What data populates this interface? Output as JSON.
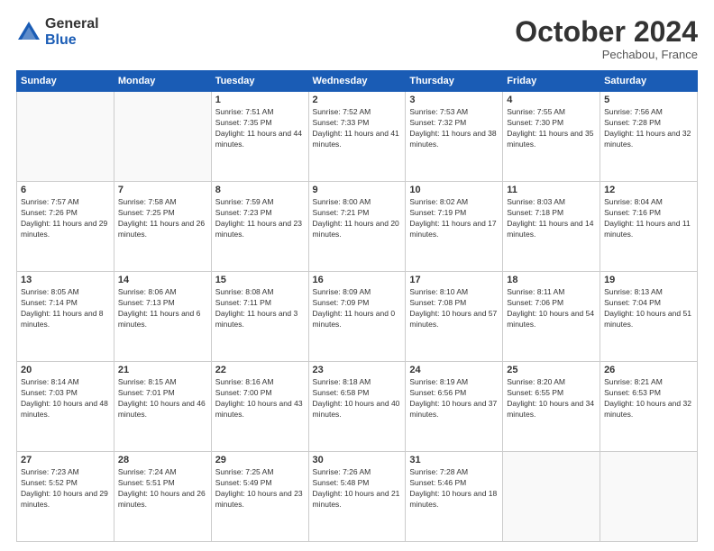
{
  "header": {
    "logo_general": "General",
    "logo_blue": "Blue",
    "month": "October 2024",
    "location": "Pechabou, France"
  },
  "days_of_week": [
    "Sunday",
    "Monday",
    "Tuesday",
    "Wednesday",
    "Thursday",
    "Friday",
    "Saturday"
  ],
  "weeks": [
    [
      {
        "day": "",
        "info": ""
      },
      {
        "day": "",
        "info": ""
      },
      {
        "day": "1",
        "info": "Sunrise: 7:51 AM\nSunset: 7:35 PM\nDaylight: 11 hours and 44 minutes."
      },
      {
        "day": "2",
        "info": "Sunrise: 7:52 AM\nSunset: 7:33 PM\nDaylight: 11 hours and 41 minutes."
      },
      {
        "day": "3",
        "info": "Sunrise: 7:53 AM\nSunset: 7:32 PM\nDaylight: 11 hours and 38 minutes."
      },
      {
        "day": "4",
        "info": "Sunrise: 7:55 AM\nSunset: 7:30 PM\nDaylight: 11 hours and 35 minutes."
      },
      {
        "day": "5",
        "info": "Sunrise: 7:56 AM\nSunset: 7:28 PM\nDaylight: 11 hours and 32 minutes."
      }
    ],
    [
      {
        "day": "6",
        "info": "Sunrise: 7:57 AM\nSunset: 7:26 PM\nDaylight: 11 hours and 29 minutes."
      },
      {
        "day": "7",
        "info": "Sunrise: 7:58 AM\nSunset: 7:25 PM\nDaylight: 11 hours and 26 minutes."
      },
      {
        "day": "8",
        "info": "Sunrise: 7:59 AM\nSunset: 7:23 PM\nDaylight: 11 hours and 23 minutes."
      },
      {
        "day": "9",
        "info": "Sunrise: 8:00 AM\nSunset: 7:21 PM\nDaylight: 11 hours and 20 minutes."
      },
      {
        "day": "10",
        "info": "Sunrise: 8:02 AM\nSunset: 7:19 PM\nDaylight: 11 hours and 17 minutes."
      },
      {
        "day": "11",
        "info": "Sunrise: 8:03 AM\nSunset: 7:18 PM\nDaylight: 11 hours and 14 minutes."
      },
      {
        "day": "12",
        "info": "Sunrise: 8:04 AM\nSunset: 7:16 PM\nDaylight: 11 hours and 11 minutes."
      }
    ],
    [
      {
        "day": "13",
        "info": "Sunrise: 8:05 AM\nSunset: 7:14 PM\nDaylight: 11 hours and 8 minutes."
      },
      {
        "day": "14",
        "info": "Sunrise: 8:06 AM\nSunset: 7:13 PM\nDaylight: 11 hours and 6 minutes."
      },
      {
        "day": "15",
        "info": "Sunrise: 8:08 AM\nSunset: 7:11 PM\nDaylight: 11 hours and 3 minutes."
      },
      {
        "day": "16",
        "info": "Sunrise: 8:09 AM\nSunset: 7:09 PM\nDaylight: 11 hours and 0 minutes."
      },
      {
        "day": "17",
        "info": "Sunrise: 8:10 AM\nSunset: 7:08 PM\nDaylight: 10 hours and 57 minutes."
      },
      {
        "day": "18",
        "info": "Sunrise: 8:11 AM\nSunset: 7:06 PM\nDaylight: 10 hours and 54 minutes."
      },
      {
        "day": "19",
        "info": "Sunrise: 8:13 AM\nSunset: 7:04 PM\nDaylight: 10 hours and 51 minutes."
      }
    ],
    [
      {
        "day": "20",
        "info": "Sunrise: 8:14 AM\nSunset: 7:03 PM\nDaylight: 10 hours and 48 minutes."
      },
      {
        "day": "21",
        "info": "Sunrise: 8:15 AM\nSunset: 7:01 PM\nDaylight: 10 hours and 46 minutes."
      },
      {
        "day": "22",
        "info": "Sunrise: 8:16 AM\nSunset: 7:00 PM\nDaylight: 10 hours and 43 minutes."
      },
      {
        "day": "23",
        "info": "Sunrise: 8:18 AM\nSunset: 6:58 PM\nDaylight: 10 hours and 40 minutes."
      },
      {
        "day": "24",
        "info": "Sunrise: 8:19 AM\nSunset: 6:56 PM\nDaylight: 10 hours and 37 minutes."
      },
      {
        "day": "25",
        "info": "Sunrise: 8:20 AM\nSunset: 6:55 PM\nDaylight: 10 hours and 34 minutes."
      },
      {
        "day": "26",
        "info": "Sunrise: 8:21 AM\nSunset: 6:53 PM\nDaylight: 10 hours and 32 minutes."
      }
    ],
    [
      {
        "day": "27",
        "info": "Sunrise: 7:23 AM\nSunset: 5:52 PM\nDaylight: 10 hours and 29 minutes."
      },
      {
        "day": "28",
        "info": "Sunrise: 7:24 AM\nSunset: 5:51 PM\nDaylight: 10 hours and 26 minutes."
      },
      {
        "day": "29",
        "info": "Sunrise: 7:25 AM\nSunset: 5:49 PM\nDaylight: 10 hours and 23 minutes."
      },
      {
        "day": "30",
        "info": "Sunrise: 7:26 AM\nSunset: 5:48 PM\nDaylight: 10 hours and 21 minutes."
      },
      {
        "day": "31",
        "info": "Sunrise: 7:28 AM\nSunset: 5:46 PM\nDaylight: 10 hours and 18 minutes."
      },
      {
        "day": "",
        "info": ""
      },
      {
        "day": "",
        "info": ""
      }
    ]
  ]
}
